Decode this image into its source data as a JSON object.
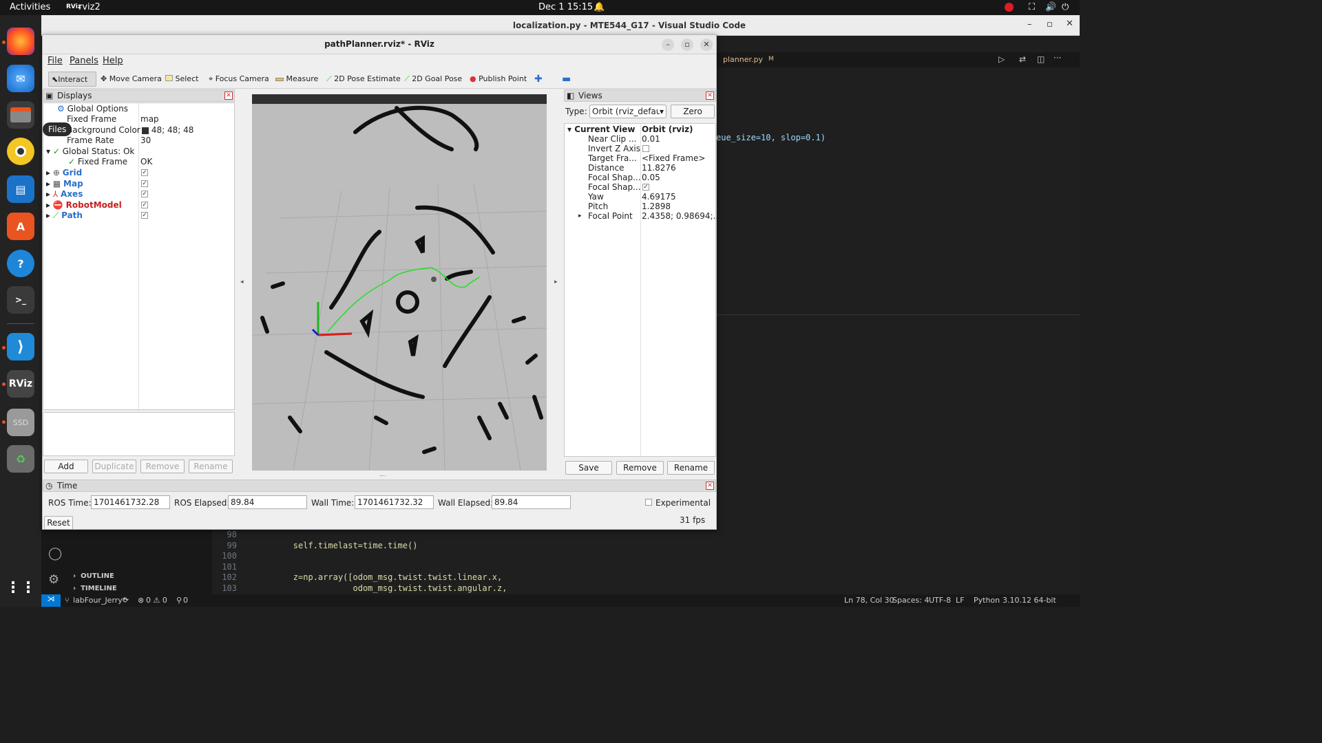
{
  "topbar": {
    "activities": "Activities",
    "app": "rviz2",
    "clock": "Dec 1  15:15"
  },
  "dock": {
    "files_tooltip": "Files",
    "ssd_label": "SSD"
  },
  "vscode": {
    "title": "localization.py - MTE544_G17 - Visual Studio Code",
    "tab": "planner.py",
    "tab_badge": "M",
    "snippet": "eue_size=10, slop=0.1)",
    "lines": [
      {
        "n": "98",
        "code": ""
      },
      {
        "n": "99",
        "code": "        self.timelast=time.time()"
      },
      {
        "n": "100",
        "code": ""
      },
      {
        "n": "101",
        "code": ""
      },
      {
        "n": "102",
        "code": "        z=np.array([odom_msg.twist.twist.linear.x,"
      },
      {
        "n": "103",
        "code": "                    odom_msg.twist.twist.angular.z,"
      }
    ],
    "outline": "OUTLINE",
    "timeline": "TIMELINE",
    "status_left": "labFour_Jerry*",
    "status_errors": "0 ⚠ 0",
    "status_ports": "0",
    "status_right": [
      "Ln 78, Col 30",
      "Spaces: 4",
      "UTF-8",
      "LF",
      "Python",
      "3.10.12 64-bit"
    ]
  },
  "rviz": {
    "title": "pathPlanner.rviz* - RViz",
    "menu": [
      "File",
      "Panels",
      "Help"
    ],
    "tools": [
      "Interact",
      "Move Camera",
      "Select",
      "Focus Camera",
      "Measure",
      "2D Pose Estimate",
      "2D Goal Pose",
      "Publish Point"
    ],
    "displays": {
      "title": "Displays",
      "global_options": "Global Options",
      "fixed_frame_label": "Fixed Frame",
      "fixed_frame_value": "map",
      "bg_label": "Background Color",
      "bg_value": "48; 48; 48",
      "fr_label": "Frame Rate",
      "fr_value": "30",
      "status_label": "Global Status: Ok",
      "ff_status_label": "Fixed Frame",
      "ff_status_value": "OK",
      "items": [
        {
          "name": "Grid",
          "color": "#2a6fc9"
        },
        {
          "name": "Map",
          "color": "#2a6fc9"
        },
        {
          "name": "Axes",
          "color": "#2a6fc9"
        },
        {
          "name": "RobotModel",
          "color": "#c81e1e"
        },
        {
          "name": "Path",
          "color": "#2a6fc9"
        }
      ],
      "buttons": [
        "Add",
        "Duplicate",
        "Remove",
        "Rename"
      ]
    },
    "views": {
      "title": "Views",
      "type_label": "Type:",
      "type_value": "Orbit (rviz_defau",
      "zero": "Zero",
      "current_view": "Current View",
      "current_view_value": "Orbit (rviz)",
      "props": [
        {
          "k": "Near Clip ...",
          "v": "0.01"
        },
        {
          "k": "Invert Z Axis",
          "v": ""
        },
        {
          "k": "Target Fra...",
          "v": "<Fixed Frame>"
        },
        {
          "k": "Distance",
          "v": "11.8276"
        },
        {
          "k": "Focal Shap...",
          "v": "0.05"
        },
        {
          "k": "Focal Shap...",
          "v": ""
        },
        {
          "k": "Yaw",
          "v": "4.69175"
        },
        {
          "k": "Pitch",
          "v": "1.2898"
        },
        {
          "k": "Focal Point",
          "v": "2.4358; 0.98694;..."
        }
      ],
      "buttons": [
        "Save",
        "Remove",
        "Rename"
      ]
    },
    "time": {
      "title": "Time",
      "ros_time_label": "ROS Time:",
      "ros_time": "1701461732.28",
      "ros_elapsed_label": "ROS Elapsed:",
      "ros_elapsed": "89.84",
      "wall_time_label": "Wall Time:",
      "wall_time": "1701461732.32",
      "wall_elapsed_label": "Wall Elapsed:",
      "wall_elapsed": "89.84",
      "experimental": "Experimental",
      "reset": "Reset",
      "fps": "31 fps"
    }
  }
}
